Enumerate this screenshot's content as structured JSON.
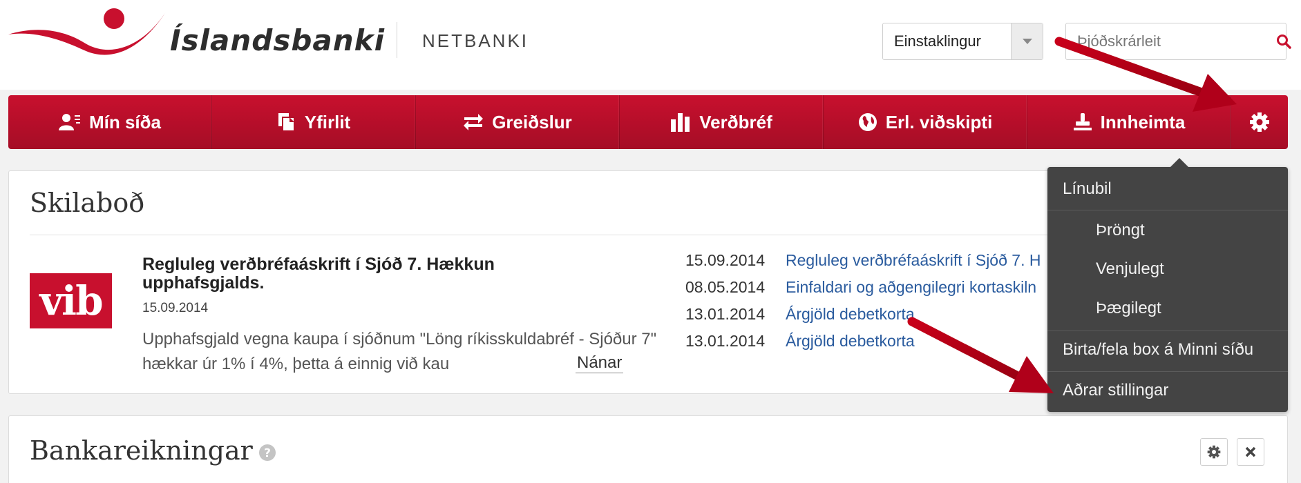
{
  "header": {
    "brand": "Íslandsbanki",
    "product": "NETBANKI",
    "user_type": {
      "selected": "Einstaklingur"
    },
    "search": {
      "placeholder": "Þjóðskrárleit"
    }
  },
  "nav": {
    "items": [
      {
        "label": "Mín síða",
        "icon": "user-icon"
      },
      {
        "label": "Yfirlit",
        "icon": "documents-icon"
      },
      {
        "label": "Greiðslur",
        "icon": "transfer-icon"
      },
      {
        "label": "Verðbréf",
        "icon": "bar-chart-icon"
      },
      {
        "label": "Erl. viðskipti",
        "icon": "globe-icon"
      },
      {
        "label": "Innheimta",
        "icon": "stamp-icon"
      }
    ],
    "settings_icon": "gear-icon"
  },
  "messages": {
    "title": "Skilaboð",
    "logo_text": "vib",
    "featured": {
      "title": "Regluleg verðbréfaáskrift í Sjóð 7. Hækkun upphafsgjalds.",
      "date": "15.09.2014",
      "body": "Upphafsgjald vegna kaupa í sjóðnum \"Löng ríkisskuldabréf - Sjóður 7\" hækkar úr 1% í 4%, þetta á einnig við kau",
      "more": "Nánar"
    },
    "list": [
      {
        "date": "15.09.2014",
        "title": "Regluleg verðbréfaáskrift í Sjóð 7. H"
      },
      {
        "date": "08.05.2014",
        "title": "Einfaldari og aðgengilegri kortaskiln"
      },
      {
        "date": "13.01.2014",
        "title": "Árgjöld debetkorta"
      },
      {
        "date": "13.01.2014",
        "title": "Árgjöld debetkorta"
      }
    ]
  },
  "accounts": {
    "title": "Bankareikningar"
  },
  "settings_menu": {
    "line_spacing": "Línubil",
    "options": [
      "Þröngt",
      "Venjulegt",
      "Þægilegt"
    ],
    "toggle_boxes": "Birta/fela box á Minni síðu",
    "other_settings": "Aðrar stillingar"
  },
  "colors": {
    "brand_red": "#c8102e",
    "menu_bg": "#444444",
    "link_blue": "#2a5b9e"
  }
}
